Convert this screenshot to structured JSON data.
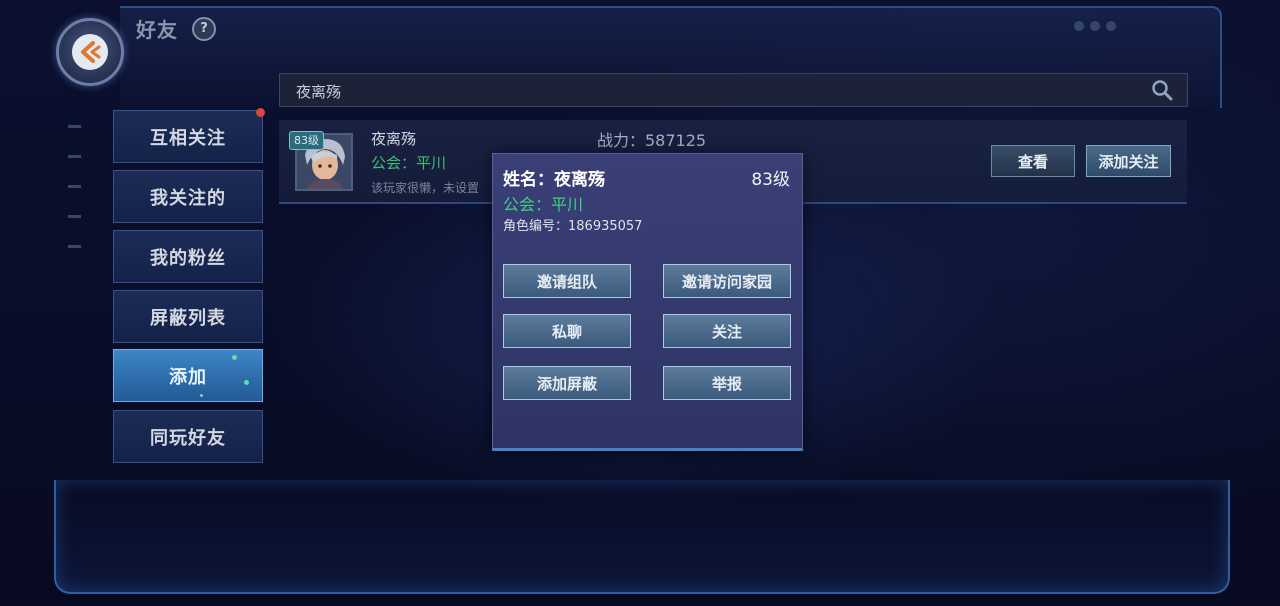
{
  "header": {
    "title": "好友",
    "help_symbol": "?"
  },
  "search": {
    "value": "夜离殇"
  },
  "sidebar": {
    "tabs": [
      {
        "label": "互相关注",
        "notification": true
      },
      {
        "label": "我关注的"
      },
      {
        "label": "我的粉丝"
      },
      {
        "label": "屏蔽列表"
      },
      {
        "label": "添加",
        "active": true
      },
      {
        "label": "同玩好友"
      }
    ]
  },
  "result": {
    "level_badge": "83级",
    "name": "夜离殇",
    "guild": "公会：平川",
    "signature": "该玩家很懒，未设置",
    "power": "战力：587125",
    "view_label": "查看",
    "follow_label": "添加关注"
  },
  "popup": {
    "name": "姓名：夜离殇",
    "level": "83级",
    "guild": "公会：平川",
    "role_id": "角色编号：186935057",
    "actions": {
      "invite_team": "邀请组队",
      "invite_home": "邀请访问家园",
      "private_chat": "私聊",
      "follow": "关注",
      "block": "添加屏蔽",
      "report": "举报"
    }
  },
  "colors": {
    "guild_green": "#3dbf77",
    "active_tab": "#3e86c6",
    "notification_red": "#d8473e"
  }
}
